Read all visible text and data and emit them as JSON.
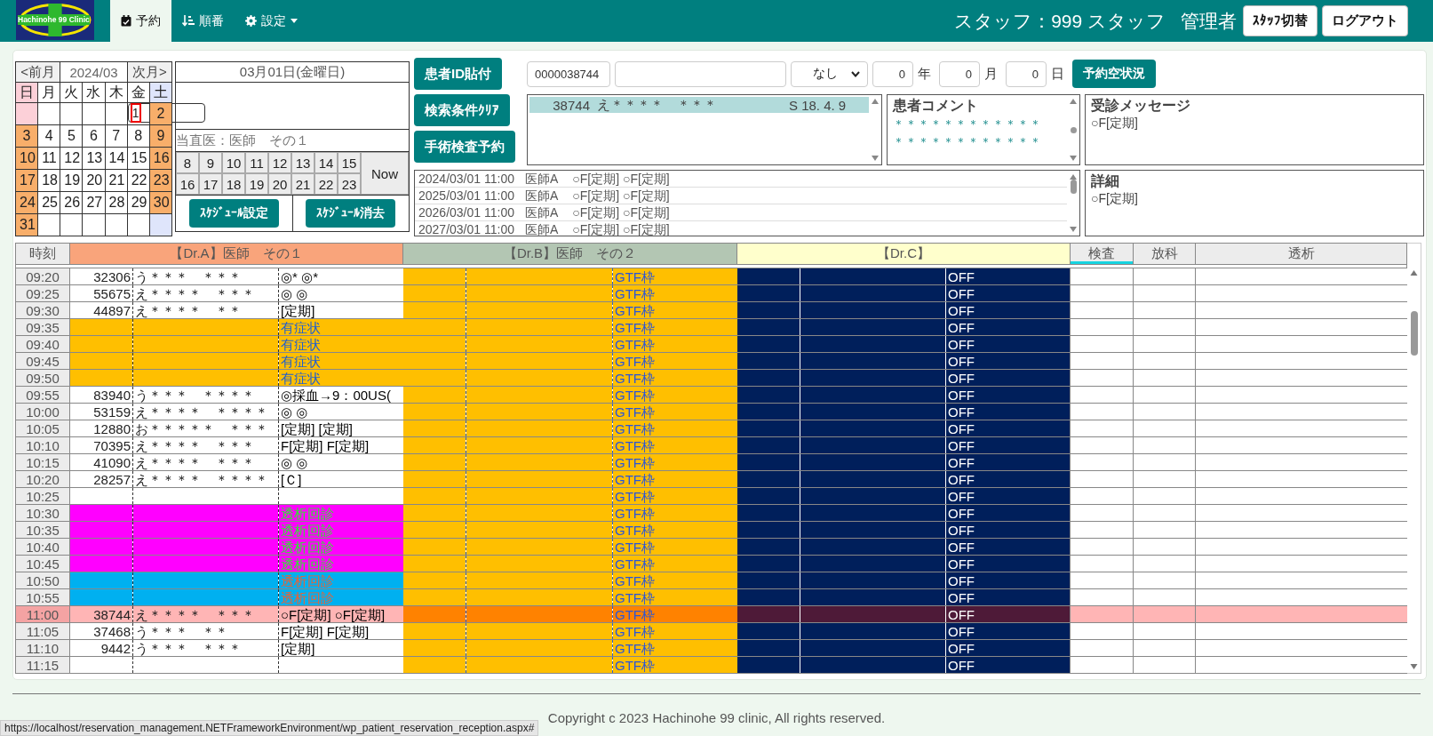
{
  "topbar": {
    "logo_text": "Hachinohe 99 Clinic",
    "tabs": [
      {
        "label": "予約",
        "selected": true,
        "dropdown": false
      },
      {
        "label": "順番",
        "selected": false,
        "dropdown": false
      },
      {
        "label": "設定",
        "selected": false,
        "dropdown": true
      }
    ],
    "staff": "スタッフ：999 スタッフ",
    "role": "管理者",
    "buttons": [
      "ｽﾀｯﾌ切替",
      "ログアウト"
    ]
  },
  "calendar": {
    "prev": "<前月",
    "month": "2024/03",
    "next": "次月>",
    "weekdays": [
      "日",
      "月",
      "火",
      "水",
      "木",
      "金",
      "土"
    ],
    "weeks": [
      [
        {
          "kind": "blank"
        },
        {
          "kind": "blank"
        },
        {
          "kind": "blank"
        },
        {
          "kind": "blank"
        },
        {
          "kind": "blank"
        },
        {
          "day": "1",
          "holiday": false,
          "selected": true
        },
        {
          "day": "2",
          "holiday": true,
          "selected": false
        }
      ],
      [
        {
          "day": "3",
          "holiday": true,
          "selected": false
        },
        {
          "day": "4",
          "holiday": false,
          "selected": false
        },
        {
          "day": "5",
          "holiday": false,
          "selected": false
        },
        {
          "day": "6",
          "holiday": false,
          "selected": false
        },
        {
          "day": "7",
          "holiday": false,
          "selected": false
        },
        {
          "day": "8",
          "holiday": false,
          "selected": false
        },
        {
          "day": "9",
          "holiday": true,
          "selected": false
        }
      ],
      [
        {
          "day": "10",
          "holiday": true,
          "selected": false
        },
        {
          "day": "11",
          "holiday": false,
          "selected": false
        },
        {
          "day": "12",
          "holiday": false,
          "selected": false
        },
        {
          "day": "13",
          "holiday": false,
          "selected": false
        },
        {
          "day": "14",
          "holiday": false,
          "selected": false
        },
        {
          "day": "15",
          "holiday": false,
          "selected": false
        },
        {
          "day": "16",
          "holiday": true,
          "selected": false
        }
      ],
      [
        {
          "day": "17",
          "holiday": true,
          "selected": false
        },
        {
          "day": "18",
          "holiday": false,
          "selected": false
        },
        {
          "day": "19",
          "holiday": false,
          "selected": false
        },
        {
          "day": "20",
          "holiday": false,
          "selected": false
        },
        {
          "day": "21",
          "holiday": false,
          "selected": false
        },
        {
          "day": "22",
          "holiday": false,
          "selected": false
        },
        {
          "day": "23",
          "holiday": true,
          "selected": false
        }
      ],
      [
        {
          "day": "24",
          "holiday": true,
          "selected": false
        },
        {
          "day": "25",
          "holiday": false,
          "selected": false
        },
        {
          "day": "26",
          "holiday": false,
          "selected": false
        },
        {
          "day": "27",
          "holiday": false,
          "selected": false
        },
        {
          "day": "28",
          "holiday": false,
          "selected": false
        },
        {
          "day": "29",
          "holiday": false,
          "selected": false
        },
        {
          "day": "30",
          "holiday": true,
          "selected": false
        }
      ],
      [
        {
          "day": "31",
          "holiday": true,
          "selected": false
        },
        {
          "kind": "blank"
        },
        {
          "kind": "blank"
        },
        {
          "kind": "blank"
        },
        {
          "kind": "blank"
        },
        {
          "kind": "blank"
        },
        {
          "kind": "blank"
        }
      ]
    ]
  },
  "day_panel": {
    "date": "03月01日(金曜日)",
    "duty": "当直医：医師　その１",
    "hours": [
      "8",
      "9",
      "10",
      "11",
      "12",
      "13",
      "14",
      "15",
      "16",
      "17",
      "18",
      "19",
      "20",
      "21",
      "22",
      "23"
    ],
    "now": "Now",
    "buttons": [
      "ｽｹｼﾞｭｰﾙ設定",
      "ｽｹｼﾞｭｰﾙ消去"
    ]
  },
  "actions": [
    "患者ID貼付",
    "検索条件ｸﾘｱ",
    "手術検査予約"
  ],
  "search": {
    "patient_id": "0000038744",
    "select": "なし",
    "year": "0",
    "year_unit": "年",
    "month": "0",
    "month_unit": "月",
    "day": "0",
    "day_unit": "日",
    "button": "予約空状況"
  },
  "patients": [
    {
      "id": "38744",
      "name": "え＊＊＊＊　＊＊＊",
      "birth": "S 18. 4. 9",
      "selected": true
    }
  ],
  "comment": {
    "title": "患者コメント",
    "lines": [
      "＊＊＊＊＊＊＊＊＊＊＊＊",
      "＊＊＊＊＊＊＊＊＊＊＊＊"
    ]
  },
  "message": {
    "title": "受診メッセージ",
    "text": "○F[定期]"
  },
  "history": [
    {
      "datetime": "2024/03/01 11:00",
      "doctor": "医師A",
      "memo": "○F[定期] ○F[定期]"
    },
    {
      "datetime": "2025/03/01 11:00",
      "doctor": "医師A",
      "memo": "○F[定期] ○F[定期]"
    },
    {
      "datetime": "2026/03/01 11:00",
      "doctor": "医師A",
      "memo": "○F[定期] ○F[定期]"
    },
    {
      "datetime": "2027/03/01 11:00",
      "doctor": "医師A",
      "memo": "○F[定期] ○F[定期]"
    }
  ],
  "detail": {
    "title": "詳細",
    "text": "○F[定期]"
  },
  "schedule": {
    "columns": [
      {
        "label": "時刻",
        "kind": "time",
        "selected": false
      },
      {
        "label": "【Dr.A】医師　その１",
        "kind": "doctor_a",
        "selected": false
      },
      {
        "label": "【Dr.B】医師　その２",
        "kind": "doctor_b",
        "selected": false
      },
      {
        "label": "【Dr.C】",
        "kind": "doctor_c",
        "selected": false
      },
      {
        "label": "検査",
        "kind": "plain",
        "selected": true
      },
      {
        "label": "放科",
        "kind": "plain",
        "selected": false
      },
      {
        "label": "透析",
        "kind": "plain",
        "selected": false
      }
    ],
    "rows": [
      {
        "time": "09:20",
        "kind": "booked",
        "id": "32306",
        "name": "う＊＊＊　＊＊＊",
        "memo": "◎* ◎*",
        "gtf": "GTF枠",
        "status": "OFF",
        "selected": false
      },
      {
        "time": "09:25",
        "kind": "booked",
        "id": "55675",
        "name": "え＊＊＊＊　＊＊＊",
        "memo": "◎ ◎",
        "gtf": "GTF枠",
        "status": "OFF",
        "selected": false
      },
      {
        "time": "09:30",
        "kind": "booked",
        "id": "44897",
        "name": "え＊＊＊＊　＊＊",
        "memo": "[定期]",
        "gtf": "GTF枠",
        "status": "OFF",
        "selected": false
      },
      {
        "time": "09:35",
        "kind": "symptom",
        "memo": "有症状",
        "gtf": "GTF枠",
        "status": "OFF",
        "selected": false
      },
      {
        "time": "09:40",
        "kind": "symptom",
        "memo": "有症状",
        "gtf": "GTF枠",
        "status": "OFF",
        "selected": false
      },
      {
        "time": "09:45",
        "kind": "symptom",
        "memo": "有症状",
        "gtf": "GTF枠",
        "status": "OFF",
        "selected": false
      },
      {
        "time": "09:50",
        "kind": "symptom",
        "memo": "有症状",
        "gtf": "GTF枠",
        "status": "OFF",
        "selected": false
      },
      {
        "time": "09:55",
        "kind": "booked",
        "id": "83940",
        "name": "う＊＊＊　＊＊＊＊",
        "memo": "◎採血→9：00US(",
        "gtf": "GTF枠",
        "status": "OFF",
        "selected": false
      },
      {
        "time": "10:00",
        "kind": "booked",
        "id": "53159",
        "name": "え＊＊＊＊　＊＊＊＊",
        "memo": "◎ ◎",
        "gtf": "GTF枠",
        "status": "OFF",
        "selected": false
      },
      {
        "time": "10:05",
        "kind": "booked",
        "id": "12880",
        "name": "お＊＊＊＊＊　＊＊＊",
        "memo": "[定期] [定期]",
        "gtf": "GTF枠",
        "status": "OFF",
        "selected": false
      },
      {
        "time": "10:10",
        "kind": "booked",
        "id": "70395",
        "name": "え＊＊＊＊　＊＊＊",
        "memo": "F[定期] F[定期]",
        "gtf": "GTF枠",
        "status": "OFF",
        "selected": false
      },
      {
        "time": "10:15",
        "kind": "booked",
        "id": "41090",
        "name": "え＊＊＊＊　＊＊＊",
        "memo": "◎ ◎",
        "gtf": "GTF枠",
        "status": "OFF",
        "selected": false
      },
      {
        "time": "10:20",
        "kind": "booked",
        "id": "28257",
        "name": "え＊＊＊＊　＊＊＊＊",
        "memo": "[Ｃ]",
        "gtf": "GTF枠",
        "status": "OFF",
        "selected": false
      },
      {
        "time": "10:25",
        "kind": "empty",
        "gtf": "GTF枠",
        "status": "OFF",
        "selected": false
      },
      {
        "time": "10:30",
        "kind": "dialysis",
        "memo": "透析回診",
        "gtf": "GTF枠",
        "status": "OFF",
        "selected": false
      },
      {
        "time": "10:35",
        "kind": "dialysis",
        "memo": "透析回診",
        "gtf": "GTF枠",
        "status": "OFF",
        "selected": false
      },
      {
        "time": "10:40",
        "kind": "dialysis",
        "memo": "透析回診",
        "gtf": "GTF枠",
        "status": "OFF",
        "selected": false
      },
      {
        "time": "10:45",
        "kind": "dialysis",
        "memo": "透析回診",
        "gtf": "GTF枠",
        "status": "OFF",
        "selected": false
      },
      {
        "time": "10:50",
        "kind": "dialysis_alt",
        "memo": "透析回診",
        "gtf": "GTF枠",
        "status": "OFF",
        "selected": false
      },
      {
        "time": "10:55",
        "kind": "dialysis_alt",
        "memo": "透析回診",
        "gtf": "GTF枠",
        "status": "OFF",
        "selected": false
      },
      {
        "time": "11:00",
        "kind": "booked",
        "id": "38744",
        "name": "え＊＊＊＊　＊＊＊",
        "memo": "○F[定期] ○F[定期]",
        "gtf": "GTF枠",
        "status": "OFF",
        "selected": true
      },
      {
        "time": "11:05",
        "kind": "booked",
        "id": "37468",
        "name": "う＊＊＊　＊＊",
        "memo": "F[定期] F[定期]",
        "gtf": "GTF枠",
        "status": "OFF",
        "selected": false
      },
      {
        "time": "11:10",
        "kind": "booked",
        "id": "9442",
        "name": "う＊＊＊　＊＊＊",
        "memo": "[定期]",
        "gtf": "GTF枠",
        "status": "OFF",
        "selected": false
      },
      {
        "time": "11:15",
        "kind": "empty",
        "gtf": "GTF枠",
        "status": "OFF",
        "selected": false
      }
    ]
  },
  "footer": {
    "copyright": "Copyright c 2023 Hachinohe 99 clinic, All rights reserved.",
    "status_url": "https://localhost/reservation_management.NETFrameworkEnvironment/wp_patient_reservation_reception.aspx#"
  }
}
